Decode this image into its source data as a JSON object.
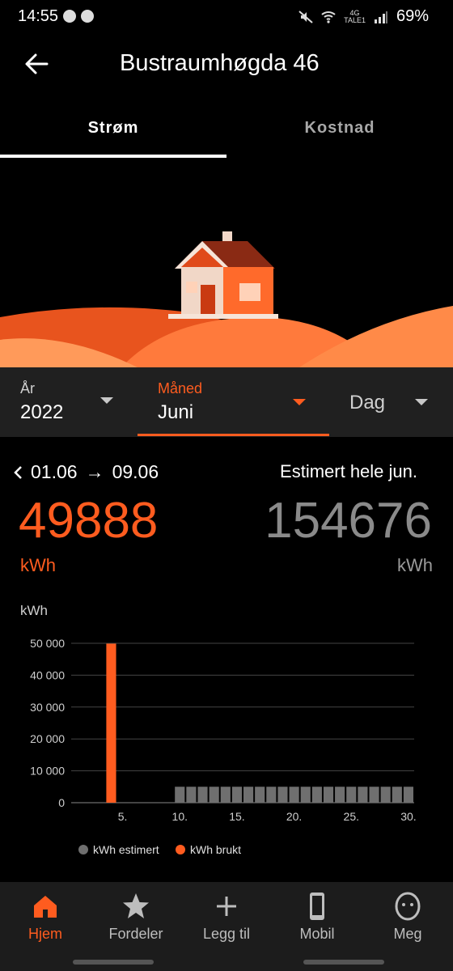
{
  "status_bar": {
    "time": "14:55",
    "network": "4G",
    "operator": "TALE1",
    "battery": "69%"
  },
  "header": {
    "title": "Bustraumhøgda 46"
  },
  "tabs": [
    {
      "label": "Strøm",
      "active": true
    },
    {
      "label": "Kostnad",
      "active": false
    }
  ],
  "period": {
    "year_label": "År",
    "year_value": "2022",
    "month_label": "Måned",
    "month_value": "Juni",
    "day_label": "Dag"
  },
  "summary": {
    "range_from": "01.06",
    "range_arrow": "→",
    "range_to": "09.06",
    "estimated_label": "Estimert hele jun.",
    "used_value": "49888",
    "used_unit": "kWh",
    "estimated_value": "154676",
    "estimated_unit": "kWh"
  },
  "chart_data": {
    "type": "bar",
    "ylabel": "kWh",
    "ylim": [
      0,
      50000
    ],
    "yticks": [
      "0",
      "10 000",
      "20 000",
      "30 000",
      "40 000",
      "50 000"
    ],
    "ytick_values": [
      0,
      10000,
      20000,
      30000,
      40000,
      50000
    ],
    "xticks": [
      "5.",
      "10.",
      "15.",
      "20.",
      "25.",
      "30."
    ],
    "xtick_days": [
      5,
      10,
      15,
      20,
      25,
      30
    ],
    "series": [
      {
        "name": "kWh brukt",
        "color": "#ff5c1f",
        "days": [
          1,
          2,
          3,
          4,
          5,
          6,
          7,
          8,
          9
        ],
        "values": [
          0,
          0,
          0,
          49888,
          0,
          0,
          0,
          0,
          0
        ]
      },
      {
        "name": "kWh estimert",
        "color": "#6f6f6f",
        "days": [
          10,
          11,
          12,
          13,
          14,
          15,
          16,
          17,
          18,
          19,
          20,
          21,
          22,
          23,
          24,
          25,
          26,
          27,
          28,
          29,
          30
        ],
        "values": [
          5000,
          5000,
          5000,
          5000,
          5000,
          5000,
          5000,
          5000,
          5000,
          5000,
          5000,
          5000,
          5000,
          5000,
          5000,
          5000,
          5000,
          5000,
          5000,
          5000,
          5000
        ]
      }
    ],
    "legend": [
      "kWh estimert",
      "kWh brukt"
    ],
    "legend_position": "bottom",
    "grid": true
  },
  "nav": [
    {
      "label": "Hjem",
      "icon": "home-icon",
      "active": true
    },
    {
      "label": "Fordeler",
      "icon": "star-icon",
      "active": false
    },
    {
      "label": "Legg til",
      "icon": "plus-icon",
      "active": false
    },
    {
      "label": "Mobil",
      "icon": "phone-icon",
      "active": false
    },
    {
      "label": "Meg",
      "icon": "profile-face-icon",
      "active": false
    }
  ],
  "colors": {
    "accent": "#ff5c1f",
    "background": "#000000",
    "panel": "#202020",
    "estimate": "#6f6f6f"
  }
}
